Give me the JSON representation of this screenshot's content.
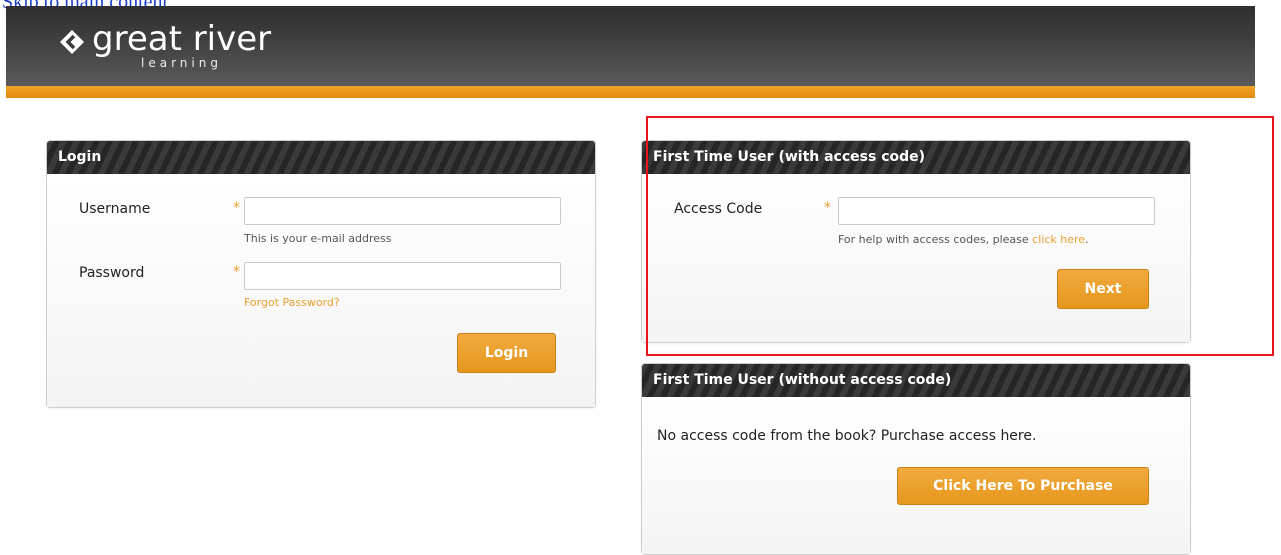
{
  "browser_link": "Skip to main content",
  "header": {
    "logo_main": "great river",
    "logo_sub": "learning",
    "logo_icon": "diamond-chevron-icon"
  },
  "login": {
    "title": "Login",
    "username_label": "Username",
    "username_value": "",
    "username_hint": "This is your e-mail address",
    "password_label": "Password",
    "password_value": "",
    "forgot_link": "Forgot Password?",
    "required_marker": "*",
    "login_button": "Login"
  },
  "first_time_code": {
    "title": "First Time User (with access code)",
    "access_code_label": "Access Code",
    "access_code_value": "",
    "required_marker": "*",
    "hint_prefix": "For help with access codes, please ",
    "hint_link": "click here",
    "hint_suffix": ".",
    "next_button": "Next"
  },
  "first_time_no_code": {
    "title": "First Time User (without access code)",
    "message": "No access code from the book? Purchase access here.",
    "purchase_button": "Click Here To Purchase"
  },
  "colors": {
    "accent_orange": "#e9a030",
    "header_dark": "#3e3e3e",
    "highlight_red": "#e8141e"
  }
}
